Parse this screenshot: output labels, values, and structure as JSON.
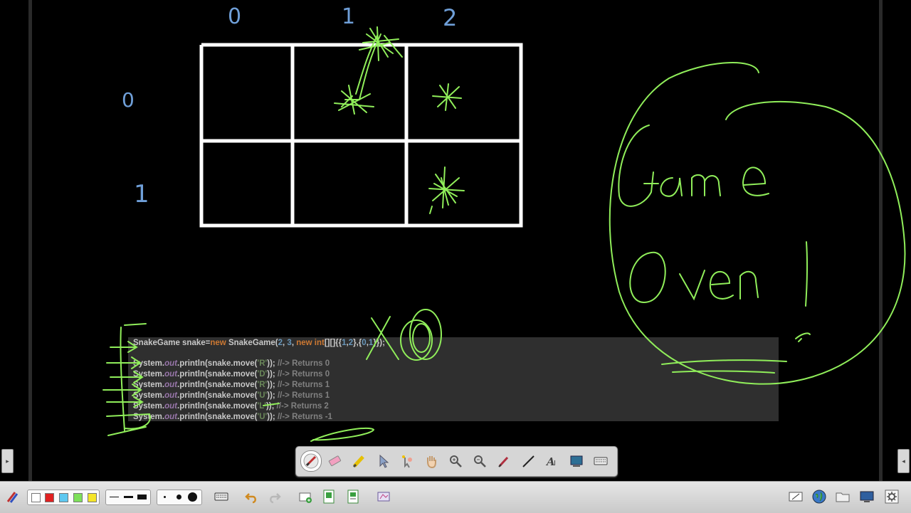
{
  "whiteboard": {
    "column_labels": [
      "0",
      "1",
      "2"
    ],
    "row_labels": [
      "0",
      "1"
    ],
    "annotation": "Game Over !",
    "colors": {
      "ink": "#90ee5a",
      "labels": "#6f9fd8",
      "grid": "#ffffff",
      "background": "#000000"
    }
  },
  "code": {
    "line1": {
      "a": "SnakeGame snake=",
      "b": "new",
      "c": " SnakeGame(",
      "d": "2",
      "e": ", ",
      "f": "3",
      "g": ", ",
      "h": "new int",
      "i": "[][]{{",
      "j": "1",
      "k": ",",
      "l": "2",
      "m": "},{",
      "n": "0",
      "o": ",",
      "p": "1",
      "q": "}});"
    },
    "calls": [
      {
        "prefix": "System.",
        "out": "out",
        "mid": ".println(snake.move(",
        "arg": "'R'",
        "suffix": ")); ",
        "comment": "//-> Returns 0"
      },
      {
        "prefix": "System.",
        "out": "out",
        "mid": ".println(snake.move(",
        "arg": "'D'",
        "suffix": ")); ",
        "comment": "//-> Returns 0"
      },
      {
        "prefix": "System.",
        "out": "out",
        "mid": ".println(snake.move(",
        "arg": "'R'",
        "suffix": ")); ",
        "comment": "//-> Returns 1"
      },
      {
        "prefix": "System.",
        "out": "out",
        "mid": ".println(snake.move(",
        "arg": "'U'",
        "suffix": ")); ",
        "comment": "//-> Returns 1"
      },
      {
        "prefix": "System.",
        "out": "out",
        "mid": ".println(snake.move(",
        "arg": "'L'",
        "suffix": ")); ",
        "comment": "//-> Returns 2"
      },
      {
        "prefix": "System.",
        "out": "out",
        "mid": ".println(snake.move(",
        "arg": "'U'",
        "suffix": ")); ",
        "comment": "//-> Returns -1"
      }
    ]
  },
  "pen_toolbar": {
    "tools": [
      "pen-icon",
      "eraser-icon",
      "highlighter-icon",
      "select-arrow-icon",
      "magic-pointer-icon",
      "hand-pan-icon",
      "zoom-in-icon",
      "zoom-out-icon",
      "dropper-icon",
      "line-icon",
      "text-recognition-icon",
      "screen-capture-icon",
      "keyboard-icon"
    ],
    "active": "pen-icon"
  },
  "bottom_bar": {
    "colors": [
      "#ffffff",
      "#e02020",
      "#5ec8f0",
      "#7ee05a",
      "#f5e52a"
    ],
    "line_widths": [
      "thin",
      "medium",
      "thick"
    ],
    "dot_sizes": [
      "small",
      "medium",
      "large"
    ],
    "left_icons": [
      "pen-tools-icon",
      "keyboard-icon",
      "undo-icon",
      "redo-icon",
      "add-page-icon",
      "page-list-icon",
      "page-export-icon",
      "clear-page-icon"
    ],
    "right_icons": [
      "whiteboard-icon",
      "globe-icon",
      "folder-icon",
      "display-icon",
      "settings-icon"
    ]
  },
  "side_tabs": {
    "left_glyph": "▸",
    "right_glyph": "◂"
  }
}
